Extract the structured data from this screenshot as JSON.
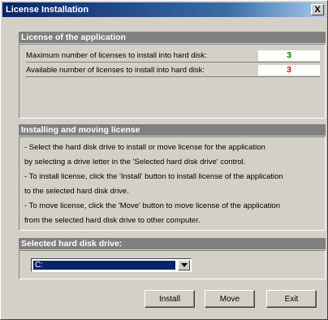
{
  "window": {
    "title": "License Installation",
    "close_label": "X"
  },
  "license": {
    "header": "License of the application",
    "max_label": "Maximum number of licenses to install into hard disk:",
    "max_value": "3",
    "max_color": "#008000",
    "available_label": "Available number of licenses to install into hard disk:",
    "available_value": "3",
    "available_color": "#d00000"
  },
  "instructions": {
    "header": "Installing and moving license",
    "lines": [
      "- Select the hard disk drive to install or move license for the application",
      "  by selecting a drive letter in the 'Selected hard disk drive' control.",
      "- To install license, click the 'Install' button to install license of the application",
      "  to the selected hard disk drive.",
      "- To move license, click the 'Move' button to move license of the application",
      "  from the selected hard disk drive to other computer."
    ]
  },
  "drive": {
    "header": "Selected hard disk drive:",
    "selected": "C:",
    "arrow_icon": "chevron-down-icon"
  },
  "buttons": {
    "install": "Install",
    "move": "Move",
    "exit": "Exit"
  }
}
